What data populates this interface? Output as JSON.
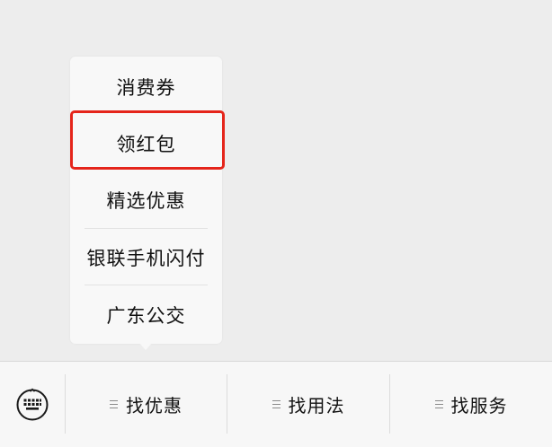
{
  "submenu": {
    "items": [
      {
        "label": "消费券"
      },
      {
        "label": "领红包"
      },
      {
        "label": "精选优惠"
      },
      {
        "label": "银联手机闪付"
      },
      {
        "label": "广东公交"
      }
    ],
    "highlighted_item": "领红包",
    "highlight_color": "#e5251b"
  },
  "bottom_bar": {
    "keyboard_icon": "keyboard-icon",
    "menu_icon": "menu-lines-icon",
    "tabs": [
      {
        "label": "找优惠"
      },
      {
        "label": "找用法"
      },
      {
        "label": "找服务"
      }
    ]
  }
}
